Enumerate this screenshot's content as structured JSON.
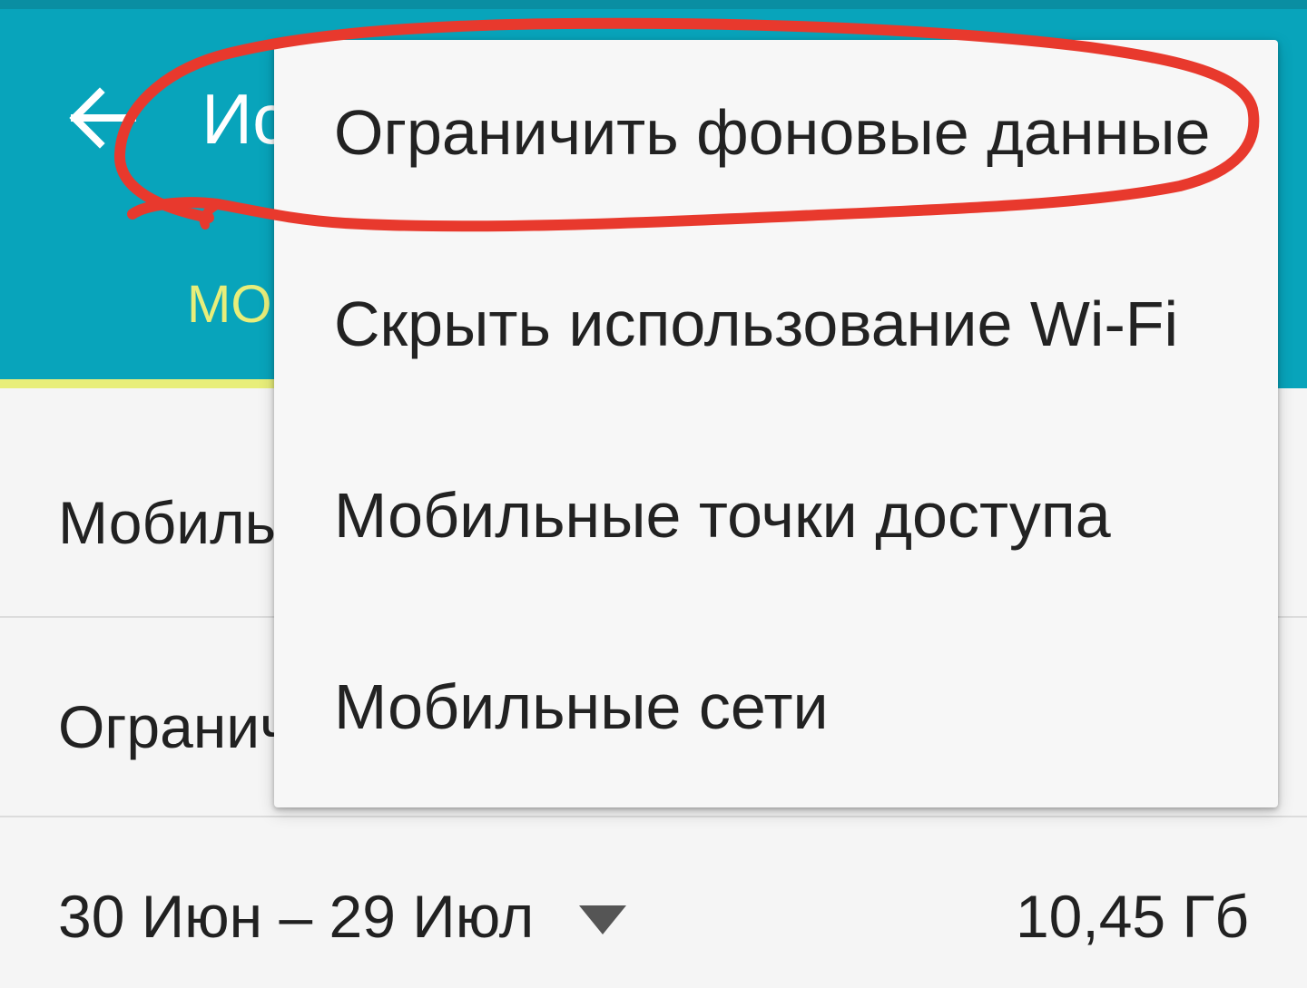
{
  "app_bar": {
    "title": "Ис",
    "background_color": "#08a4bb",
    "back_icon": "arrow-left-icon"
  },
  "tabs": [
    {
      "label": "МО",
      "selected": true,
      "indicator_color": "#e8ee7a"
    }
  ],
  "settings": {
    "rows": [
      {
        "label": "Мобиль"
      },
      {
        "label": "Огранич"
      }
    ],
    "cycle": {
      "date_range": "30 Июн – 29 Июл",
      "dropdown_icon": "triangle-down-icon",
      "usage_total": "10,45 Гб"
    }
  },
  "overflow_menu": {
    "items": [
      {
        "label": "Ограничить фоновые данные",
        "highlighted": true
      },
      {
        "label": "Скрыть использование Wi-Fi"
      },
      {
        "label": "Мобильные точки доступа"
      },
      {
        "label": "Мобильные сети"
      }
    ]
  },
  "annotation": {
    "shape": "hand-drawn circle",
    "color": "#e8392d"
  }
}
